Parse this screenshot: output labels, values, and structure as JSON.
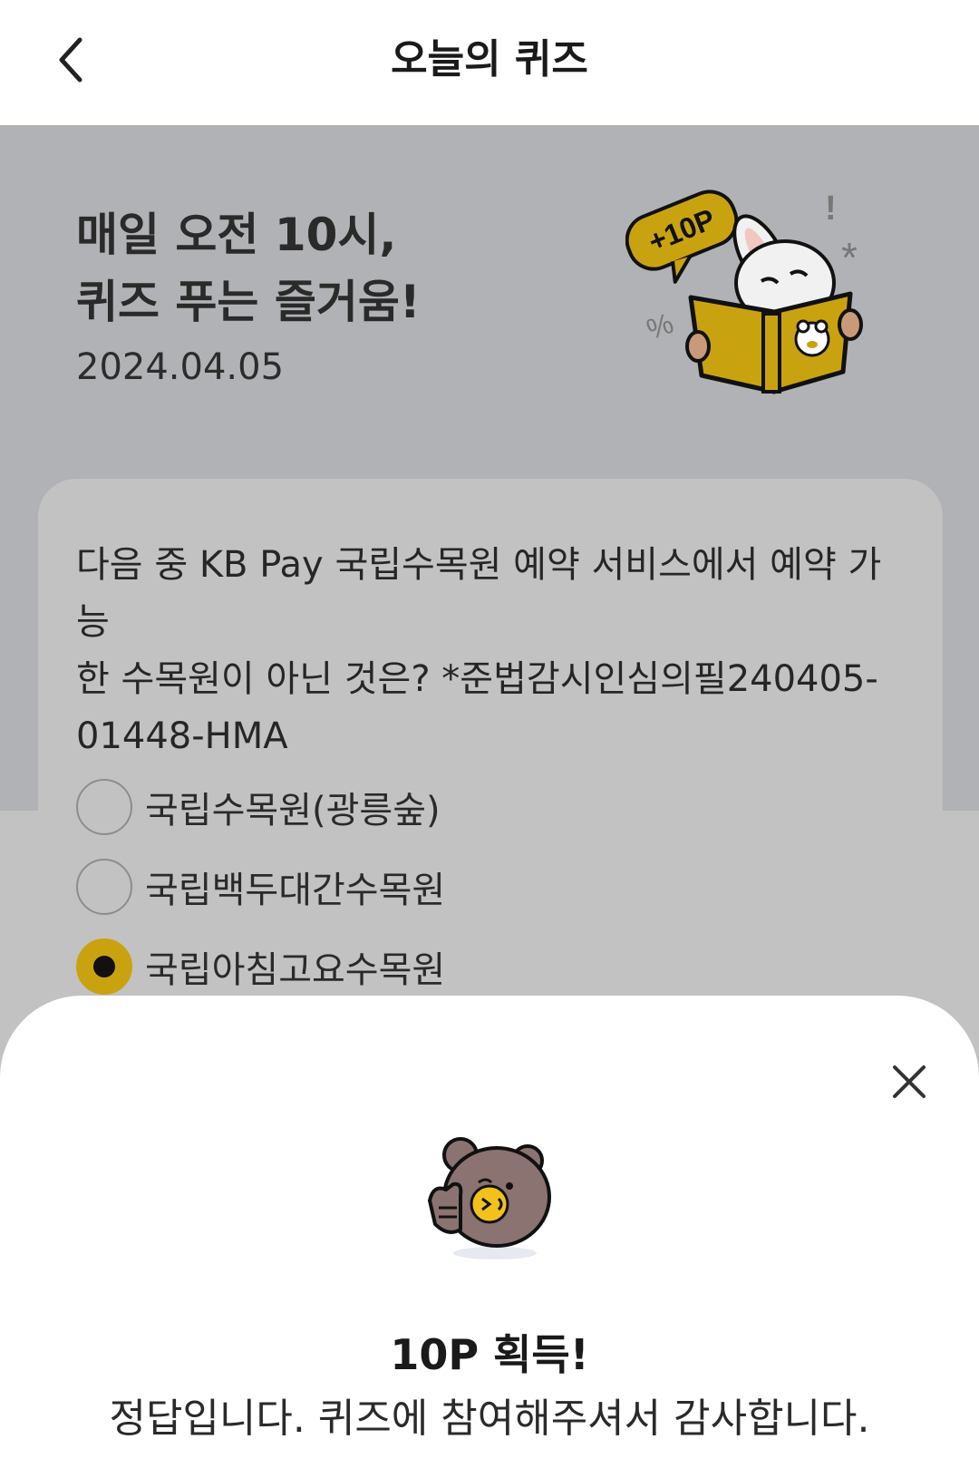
{
  "header": {
    "title": "오늘의 퀴즈"
  },
  "hero": {
    "title_line1": "매일 오전 10시,",
    "title_line2": "퀴즈 푸는 즐거움!",
    "date": "2024.04.05",
    "badge": "+10P"
  },
  "quiz": {
    "question_line1": "다음 중 KB Pay 국립수목원 예약 서비스에서 예약 가능",
    "question_line2": "한 수목원이 아닌 것은? *준법감시인심의필240405-",
    "question_line3": "01448-HMA",
    "options": [
      {
        "label": "국립수목원(광릉숲)",
        "selected": false
      },
      {
        "label": "국립백두대간수목원",
        "selected": false
      },
      {
        "label": "국립아침고요수목원",
        "selected": true
      }
    ]
  },
  "result": {
    "title": "10P 획득!",
    "message": "정답입니다. 퀴즈에 참여해주셔서 감사합니다."
  },
  "colors": {
    "accent": "#c9a30f",
    "banner_bg": "#b1b2b5",
    "card_bg": "#c2c2c2"
  },
  "icons": [
    "chevron-left-icon",
    "close-icon"
  ]
}
